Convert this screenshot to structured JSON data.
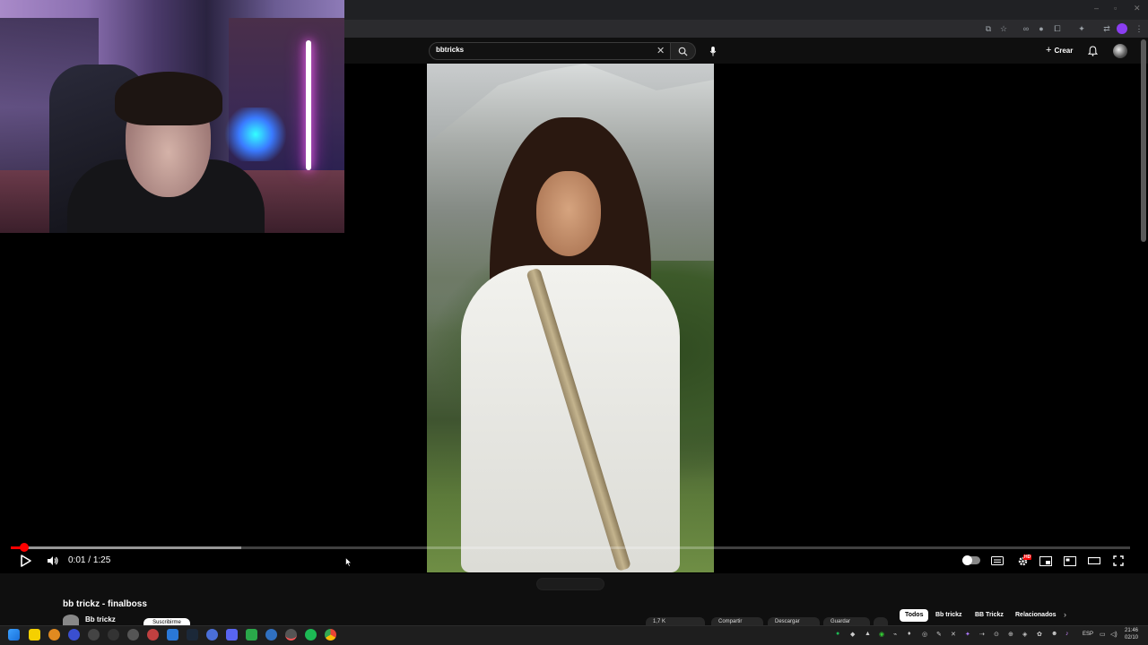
{
  "search": {
    "query": "bbtricks"
  },
  "header": {
    "create_label": "Crear"
  },
  "player": {
    "current_time": "0:01",
    "separator": "/",
    "duration": "1:25",
    "progress_fraction": 0.0118,
    "buffered_fraction": 0.206,
    "quality_badge": "HD"
  },
  "video": {
    "title": "bb trickz - finalboss",
    "channel": "Bb trickz",
    "subscribe_label": "Suscribirme",
    "actions": [
      "1,7 K",
      "Compartir",
      "Descargar",
      "Guardar"
    ]
  },
  "chips": [
    "Todos",
    "Bb trickz",
    "BB Trickz",
    "Relacionados"
  ],
  "taskbar": {
    "lang": "ESP",
    "time": "21:46",
    "date": "02/10"
  },
  "colors": {
    "accent": "#ff0000",
    "background": "#0f0f0f",
    "extension_highlight": "#8b3ef2"
  },
  "icons": [
    "search-icon",
    "mic-icon",
    "close-icon",
    "bell-icon",
    "play-icon",
    "volume-icon",
    "subtitles-icon",
    "settings-icon",
    "miniplayer-icon",
    "theater-icon",
    "fullscreen-icon",
    "windows-start-icon"
  ]
}
